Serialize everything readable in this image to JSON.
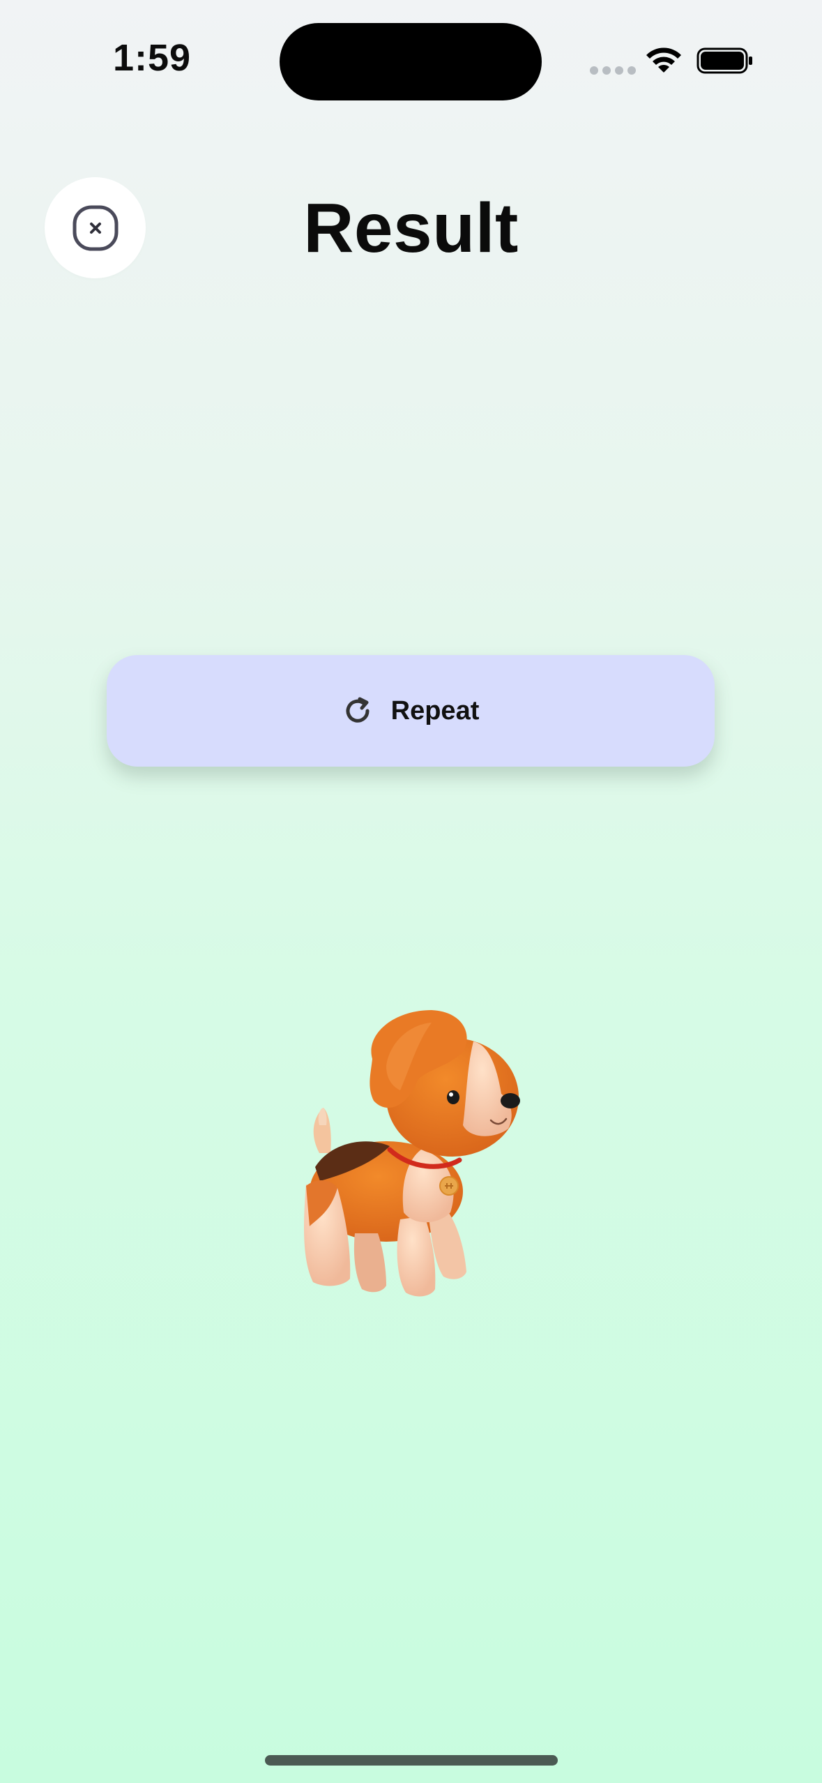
{
  "status_bar": {
    "time": "1:59",
    "icons": [
      "signal-dots-icon",
      "wifi-icon",
      "battery-icon"
    ]
  },
  "header": {
    "title": "Result",
    "close_icon": "close-icon"
  },
  "actions": {
    "repeat_label": "Repeat",
    "repeat_icon": "refresh-icon"
  },
  "illustration": {
    "name": "dog-illustration"
  },
  "colors": {
    "repeat_button_bg": "#d7dcfd",
    "background_top": "#f1f3f5",
    "background_bottom": "#c8fcdf"
  }
}
